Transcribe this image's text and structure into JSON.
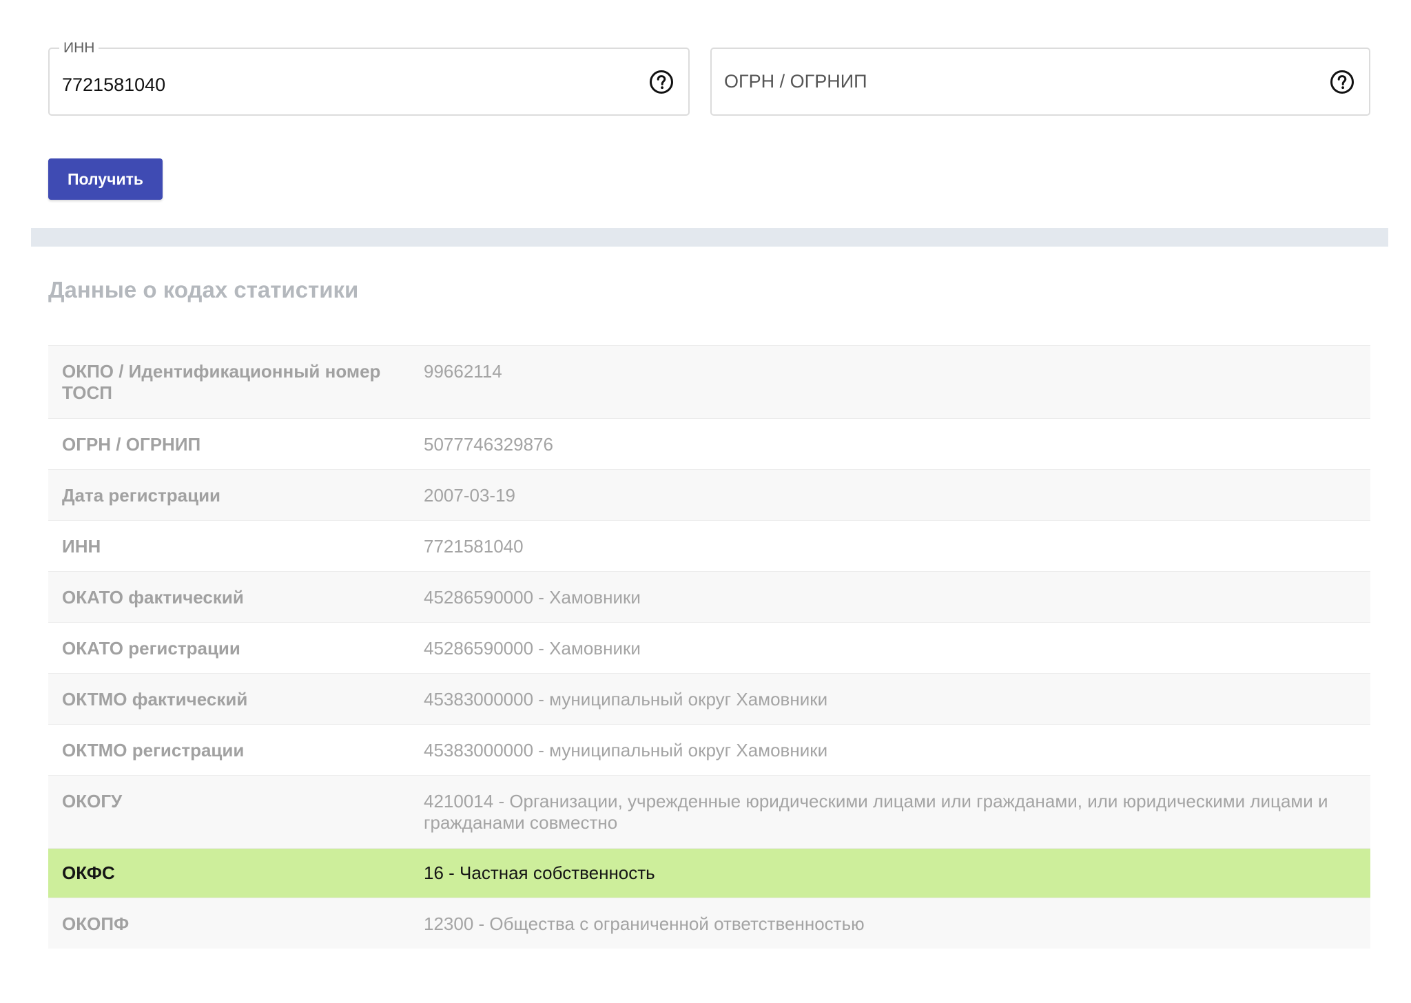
{
  "form": {
    "inn_field": {
      "legend": "ИНН",
      "value": "7721581040",
      "help_icon": "question-circle-icon"
    },
    "ogrn_field": {
      "placeholder": "ОГРН / ОГРНИП",
      "value": "",
      "help_icon": "question-circle-icon"
    },
    "submit_label": "Получить",
    "accent_color": "#3f4bb3"
  },
  "section": {
    "title": "Данные о кодах статистики"
  },
  "stats": [
    {
      "label": "ОКПО / Идентификационный номер ТОСП",
      "value": "99662114"
    },
    {
      "label": "ОГРН / ОГРНИП",
      "value": "5077746329876"
    },
    {
      "label": "Дата регистрации",
      "value": "2007-03-19"
    },
    {
      "label": "ИНН",
      "value": "7721581040"
    },
    {
      "label": "ОКАТО фактический",
      "value": "45286590000 - Хамовники"
    },
    {
      "label": "ОКАТО регистрации",
      "value": "45286590000 - Хамовники"
    },
    {
      "label": "ОКТМО фактический",
      "value": "45383000000 - муниципальный округ Хамовники"
    },
    {
      "label": "ОКТМО регистрации",
      "value": "45383000000 - муниципальный округ Хамовники"
    },
    {
      "label": "ОКОГУ",
      "value": "4210014 - Организации, учрежденные юридическими лицами или гражданами, или юридическими лицами и гражданами совместно"
    },
    {
      "label": "ОКФС",
      "value": "16 - Частная собственность",
      "highlighted": true
    },
    {
      "label": "ОКОПФ",
      "value": "12300 - Общества с ограниченной ответственностью"
    }
  ],
  "colors": {
    "highlight_row": "#cdee9b",
    "divider": "#e3e8ee",
    "section_title": "#b4b8bd"
  }
}
